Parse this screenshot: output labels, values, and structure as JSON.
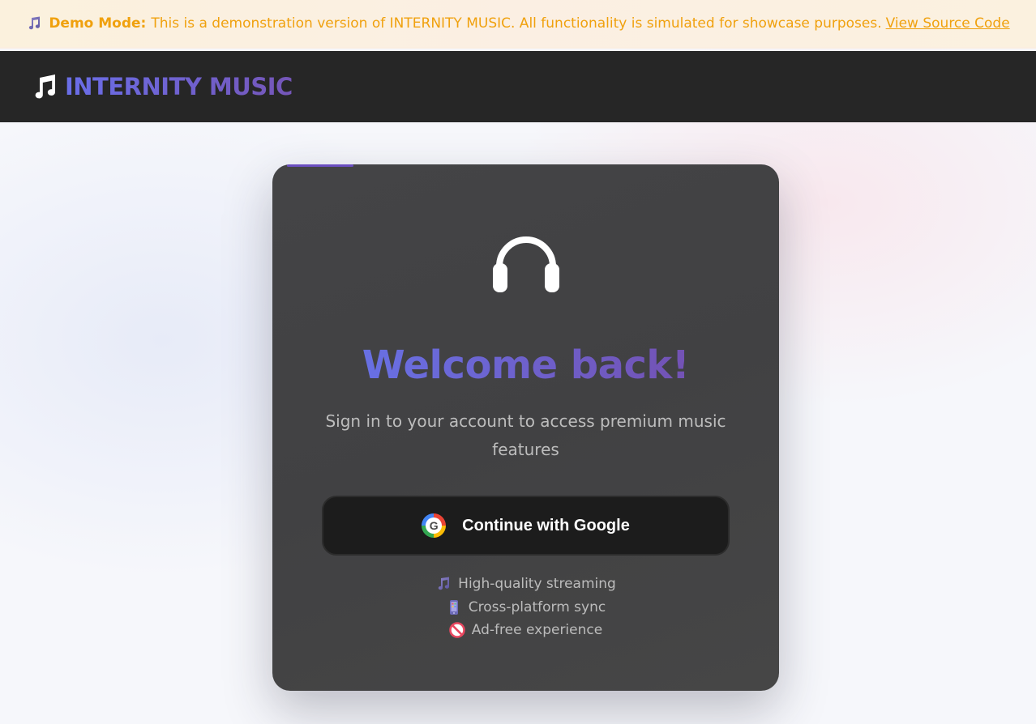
{
  "banner": {
    "label": "Demo Mode:",
    "message": "This is a demonstration version of INTERNITY MUSIC. All functionality is simulated for showcase purposes.",
    "link": "View Source Code",
    "icon": "music-note-icon"
  },
  "header": {
    "logo_text": "INTERNITY MUSIC",
    "logo_icon": "music-note-icon"
  },
  "login": {
    "title": "Welcome back!",
    "subtitle": "Sign in to your account to access premium music features",
    "google_button": "Continue with Google",
    "google_icon_letter": "G",
    "hero_icon": "headphones-icon"
  },
  "features": [
    {
      "icon": "music-note-icon",
      "label": "High-quality streaming"
    },
    {
      "icon": "mobile-phone-icon",
      "label": "Cross-platform sync"
    },
    {
      "icon": "no-entry-icon",
      "label": "Ad-free experience"
    }
  ],
  "colors": {
    "brand_gradient_start": "#6a6ee8",
    "brand_gradient_end": "#7556b8",
    "banner_text": "#f0a10e",
    "header_bg": "#262626",
    "card_bg": "#434345"
  }
}
